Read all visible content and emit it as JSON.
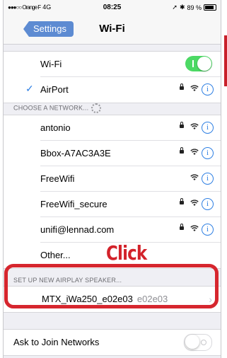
{
  "status_bar": {
    "carrier": "●●●○○ Orange F",
    "network": "4G",
    "time": "08:25",
    "battery": "89 %"
  },
  "navbar": {
    "back_label": "Settings",
    "title": "Wi-Fi"
  },
  "wifi_toggle": {
    "label": "Wi-Fi",
    "state": "on"
  },
  "connected": {
    "name": "AirPort",
    "secured": true
  },
  "choose_section": {
    "header": "CHOOSE A NETWORK..."
  },
  "networks": [
    {
      "name": "antonio",
      "secured": true
    },
    {
      "name": "Bbox-A7AC3A3E",
      "secured": true
    },
    {
      "name": "FreeWifi",
      "secured": false
    },
    {
      "name": "FreeWifi_secure",
      "secured": true
    },
    {
      "name": "unifi@lennad.com",
      "secured": true
    }
  ],
  "other": {
    "label": "Other..."
  },
  "annotation": {
    "text": "Click",
    "color": "#d3222a"
  },
  "airplay_section": {
    "header": "SET UP NEW AIRPLAY SPEAKER...",
    "device_name": "MTX_iWa250_e02e03",
    "device_id": "e02e03"
  },
  "ask_to_join": {
    "label": "Ask to Join Networks",
    "state": "off"
  },
  "colors": {
    "accent": "#2e7fe3",
    "toggle_on": "#4cd964",
    "highlight": "#d6262e",
    "back_button": "#5d8bd2"
  }
}
